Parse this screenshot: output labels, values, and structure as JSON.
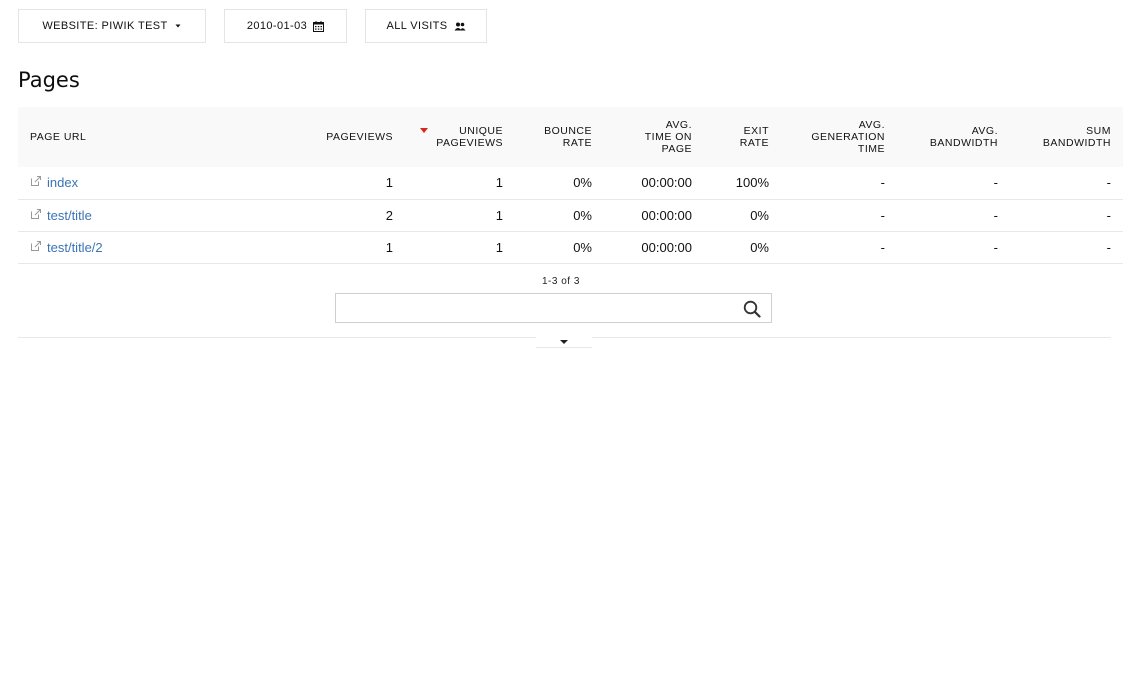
{
  "topbar": {
    "site_selector": "WEBSITE: PIWIK TEST",
    "date_selector": "2010-01-03",
    "segment_selector": "ALL VISITS"
  },
  "report": {
    "title": "Pages",
    "columns": [
      {
        "key": "label",
        "lines": [
          "PAGE URL"
        ]
      },
      {
        "key": "nb_hits",
        "lines": [
          "PAGEVIEWS"
        ]
      },
      {
        "key": "nb_visits",
        "lines": [
          "UNIQUE",
          "PAGEVIEWS"
        ]
      },
      {
        "key": "bounce_rate",
        "lines": [
          "BOUNCE",
          "RATE"
        ]
      },
      {
        "key": "avg_time",
        "lines": [
          "AVG.",
          "TIME ON",
          "PAGE"
        ]
      },
      {
        "key": "exit_rate",
        "lines": [
          "EXIT",
          "RATE"
        ]
      },
      {
        "key": "avg_gen",
        "lines": [
          "AVG.",
          "GENERATION",
          "TIME"
        ]
      },
      {
        "key": "avg_bw",
        "lines": [
          "AVG.",
          "BANDWIDTH"
        ]
      },
      {
        "key": "sum_bw",
        "lines": [
          "SUM",
          "BANDWIDTH"
        ]
      }
    ],
    "sorted_column": "nb_visits",
    "rows": [
      {
        "label": "index",
        "nb_hits": "1",
        "nb_visits": "1",
        "bounce_rate": "0%",
        "avg_time": "00:00:00",
        "exit_rate": "100%",
        "avg_gen": "-",
        "avg_bw": "-",
        "sum_bw": "-"
      },
      {
        "label": "test/title",
        "nb_hits": "2",
        "nb_visits": "1",
        "bounce_rate": "0%",
        "avg_time": "00:00:00",
        "exit_rate": "0%",
        "avg_gen": "-",
        "avg_bw": "-",
        "sum_bw": "-"
      },
      {
        "label": "test/title/2",
        "nb_hits": "1",
        "nb_visits": "1",
        "bounce_rate": "0%",
        "avg_time": "00:00:00",
        "exit_rate": "0%",
        "avg_gen": "-",
        "avg_bw": "-",
        "sum_bw": "-"
      }
    ],
    "pagination": "1-3 of 3",
    "search_value": ""
  },
  "icons": {
    "site": "caret-down-icon",
    "date": "calendar-icon",
    "segment": "users-icon",
    "row": "external-link-icon",
    "search": "search-icon",
    "sort": "sort-desc-icon",
    "expand": "expand-caret-icon"
  },
  "colors": {
    "link": "#3b73b9",
    "sort_arrow": "#d4291f",
    "header_bg": "#f9f9f9"
  }
}
